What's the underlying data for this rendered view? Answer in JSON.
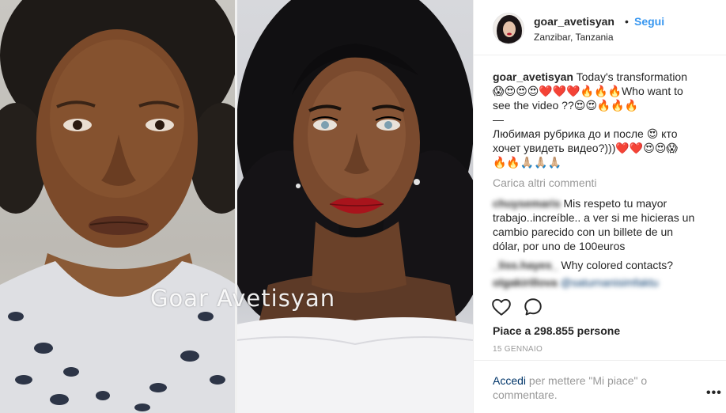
{
  "post": {
    "watermark": "Goar Avetisyan"
  },
  "header": {
    "username": "goar_avetisyan",
    "separator": "•",
    "follow_label": "Segui",
    "location": "Zanzibar, Tanzania"
  },
  "caption": {
    "username": "goar_avetisyan",
    "line1": "Today's transformation",
    "line2": "😱😍😍😍❤️❤️❤️🔥🔥🔥Who want to",
    "line3": "see the video ??😍😍🔥🔥🔥",
    "line4": "—",
    "line5": "Любимая рубрика до и после 😍 кто",
    "line6": "хочет увидеть видео?)))❤️❤️😍😍😱",
    "line7": "🔥🔥🙏🏼🙏🏼🙏🏼"
  },
  "load_more_label": "Carica altri commenti",
  "comments": [
    {
      "username": "chuysemaris",
      "lines": [
        "Mis respeto tu mayor",
        "trabajo..increíble.. a ver si me hicieras un",
        "cambio parecido con un billete de un",
        "dólar, por uno de 100euros"
      ]
    },
    {
      "username": "_liss.hayes_",
      "text": "Why colored contacts?"
    },
    {
      "username": "olgakirillova",
      "mention": "@saturnanisimfaktu"
    }
  ],
  "actions": {
    "like_icon": "heart-icon",
    "comment_icon": "comment-bubble-icon"
  },
  "likes_text": "Piace a 298.855 persone",
  "date": "15 GENNAIO",
  "login": {
    "link": "Accedi",
    "rest_line1": " per mettere \"Mi piace\" o",
    "line2": "commentare."
  },
  "more_options": "•••",
  "colors": {
    "accent_blue": "#3897f0",
    "link_navy": "#003569",
    "muted_gray": "#999999",
    "text": "#262626"
  }
}
